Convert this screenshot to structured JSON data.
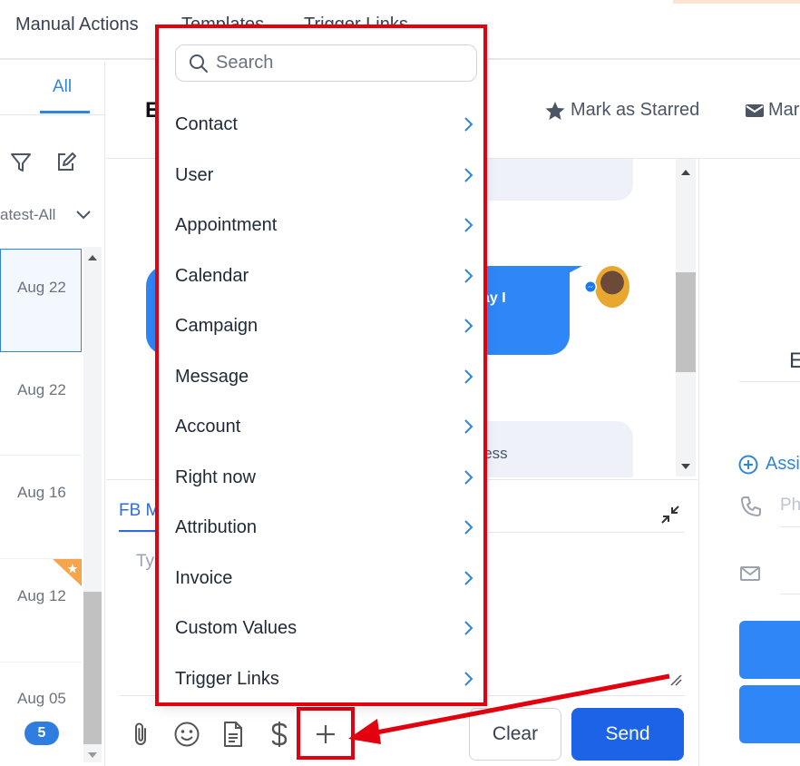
{
  "topbar": {
    "items": [
      "Manual Actions",
      "Templates",
      "Trigger Links"
    ]
  },
  "left": {
    "tab_all": "All",
    "sort_label": "atest-All",
    "conversations": [
      {
        "date": "Aug 22"
      },
      {
        "date": "Aug 22"
      },
      {
        "date": "Aug 16"
      },
      {
        "date": "Aug 12"
      },
      {
        "date": "Aug 05",
        "badge": "5"
      }
    ]
  },
  "chat": {
    "title_fragment": "E",
    "header_fragment": "e",
    "mark_starred": "Mark as Starred",
    "mark_unread_fragment": "Mar",
    "blue_bubble_fragment": "ay I",
    "grey_bubble_fragment": "iness"
  },
  "composer": {
    "channel_tab": "FB M",
    "placeholder": "Typ",
    "clear_label": "Clear",
    "send_label": "Send"
  },
  "right_panel": {
    "name_fragment": "E",
    "assign_label": "Assi",
    "phone_placeholder": "Ph"
  },
  "menu": {
    "search_placeholder": "Search",
    "items": [
      {
        "label": "Contact"
      },
      {
        "label": "User"
      },
      {
        "label": "Appointment"
      },
      {
        "label": "Calendar"
      },
      {
        "label": "Campaign"
      },
      {
        "label": "Message"
      },
      {
        "label": "Account"
      },
      {
        "label": "Right now"
      },
      {
        "label": "Attribution"
      },
      {
        "label": "Invoice"
      },
      {
        "label": "Custom Values"
      },
      {
        "label": "Trigger Links"
      }
    ]
  },
  "colors": {
    "accent": "#2f86d6",
    "send": "#1d63e8",
    "annotation": "#e3000f"
  }
}
